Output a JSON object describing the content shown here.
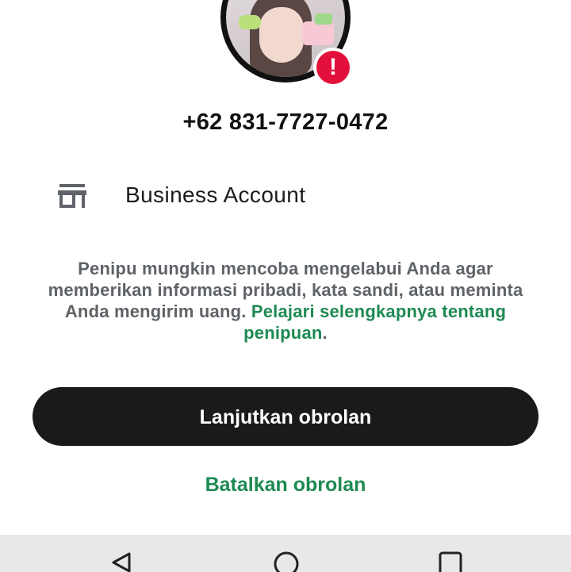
{
  "contact": {
    "phone": "+62 831-7727-0472",
    "alert_symbol": "!"
  },
  "business": {
    "icon": "store-icon",
    "label": "Business Account"
  },
  "warning": {
    "text": "Penipu mungkin mencoba mengelabui Anda agar memberikan informasi pribadi, kata sandi, atau meminta Anda mengirim uang. ",
    "link_text": "Pelajari selengkapnya tentang penipuan",
    "trailing": "."
  },
  "actions": {
    "continue_label": "Lanjutkan obrolan",
    "cancel_label": "Batalkan obrolan"
  },
  "navbar": {
    "back_icon": "back-triangle-icon",
    "home_icon": "home-circle-icon",
    "recent_icon": "recent-square-icon"
  },
  "colors": {
    "accent_green": "#1d8a52",
    "alert_red": "#e3103c",
    "button_dark": "#1a1a1a",
    "text_gray": "#5f6368"
  }
}
